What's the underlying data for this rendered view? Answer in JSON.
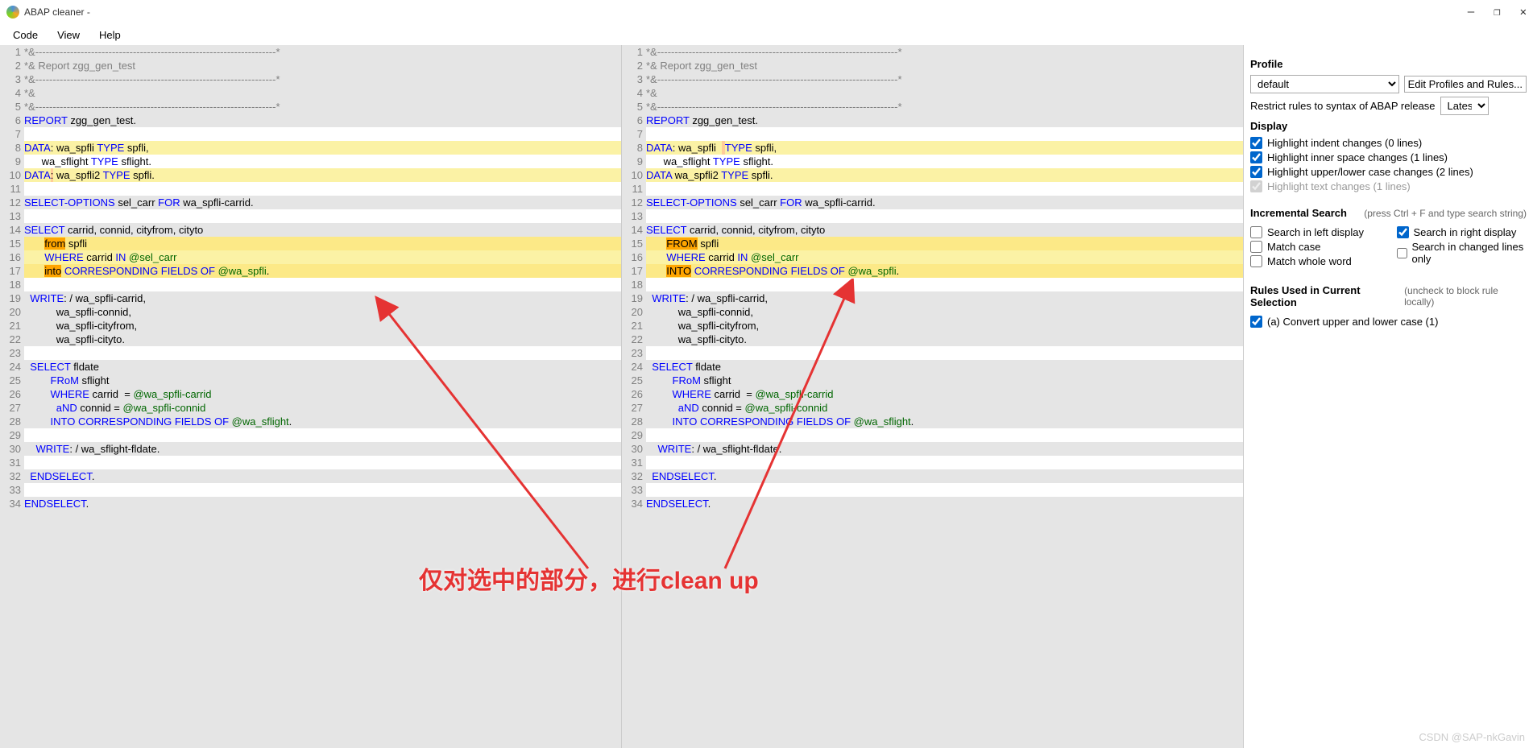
{
  "window": {
    "title": "ABAP cleaner - ",
    "controls": {
      "min": "—",
      "max": "❐",
      "close": "✕"
    }
  },
  "menu": {
    "code": "Code",
    "view": "View",
    "help": "Help"
  },
  "sidebar": {
    "profile_h": "Profile",
    "profile_val": "default",
    "edit_btn": "Edit Profiles and Rules...",
    "restrict": "Restrict rules to syntax of ABAP release",
    "restrict_val": "Latest",
    "display_h": "Display",
    "hl_indent": "Highlight indent changes (0 lines)",
    "hl_inner": "Highlight inner space changes (1 lines)",
    "hl_case": "Highlight upper/lower case changes (2 lines)",
    "hl_text": "Highlight text changes (1 lines)",
    "search_h": "Incremental Search",
    "search_hint": "(press Ctrl + F and type search string)",
    "s_left": "Search in left display",
    "s_right": "Search in right display",
    "s_case": "Match case",
    "s_changed": "Search in changed lines only",
    "s_whole": "Match whole word",
    "rules_h": "Rules Used in Current Selection",
    "rules_hint": "(uncheck to block rule locally)",
    "rule_a": "(a) Convert upper and lower case (1)"
  },
  "annotation": "仅对选中的部分，进行clean up",
  "watermark": "CSDN @SAP-nkGavin",
  "left_code": [
    {
      "n": 1,
      "cls": "bg-e5",
      "h": "<span class=com>*&amp;---------------------------------------------------------------------*</span>"
    },
    {
      "n": 2,
      "cls": "bg-e5",
      "h": "<span class=com>*&amp; Report zgg_gen_test</span>"
    },
    {
      "n": 3,
      "cls": "bg-e5",
      "h": "<span class=com>*&amp;---------------------------------------------------------------------*</span>"
    },
    {
      "n": 4,
      "cls": "bg-e5",
      "h": "<span class=com>*&amp;</span>"
    },
    {
      "n": 5,
      "cls": "bg-e5",
      "h": "<span class=com>*&amp;---------------------------------------------------------------------*</span>"
    },
    {
      "n": 6,
      "cls": "bg-e5",
      "h": "<span class=kw>REPORT</span> zgg_gen_test."
    },
    {
      "n": 7,
      "cls": "bg-ff",
      "h": ""
    },
    {
      "n": 8,
      "cls": "hl-yellow",
      "h": "<span class=kw>DATA</span>: wa_spfli <span class=kw>TYPE</span> spfli,"
    },
    {
      "n": 9,
      "cls": "bg-ff",
      "h": "      wa_sflight <span class=kw>TYPE</span> sflight."
    },
    {
      "n": 10,
      "cls": "hl-yellow",
      "h": "<span class=kw>DATA</span><span class=hl-orange>:</span> wa_spfli2 <span class=kw>TYPE</span> spfli."
    },
    {
      "n": 11,
      "cls": "bg-ff",
      "h": ""
    },
    {
      "n": 12,
      "cls": "bg-e5",
      "h": "<span class=kw>SELECT-OPTIONS</span> sel_carr <span class=kw>FOR</span> wa_spfli-carrid."
    },
    {
      "n": 13,
      "cls": "bg-ff",
      "h": ""
    },
    {
      "n": 14,
      "cls": "bg-e5",
      "h": "<span class=kw>SELECT</span> carrid, connid, cityfrom, cityto"
    },
    {
      "n": 15,
      "cls": "hl-yellow2",
      "h": "       <span class=sel>from</span> spfli"
    },
    {
      "n": 16,
      "cls": "hl-yellow",
      "h": "       <span class=kw>WHERE</span> carrid <span class=kw>IN</span> <span class=at>@sel_carr</span>"
    },
    {
      "n": 17,
      "cls": "hl-yellow2",
      "h": "       <span class=sel>into</span> <span class=kw>CORRESPONDING FIELDS OF</span> <span class=at>@wa_spfli</span>."
    },
    {
      "n": 18,
      "cls": "bg-ff",
      "h": ""
    },
    {
      "n": 19,
      "cls": "bg-e5",
      "h": "  <span class=kw>WRITE</span>: / wa_spfli-carrid,"
    },
    {
      "n": 20,
      "cls": "bg-e5",
      "h": "           wa_spfli-connid,"
    },
    {
      "n": 21,
      "cls": "bg-e5",
      "h": "           wa_spfli-cityfrom,"
    },
    {
      "n": 22,
      "cls": "bg-e5",
      "h": "           wa_spfli-cityto."
    },
    {
      "n": 23,
      "cls": "bg-ff",
      "h": ""
    },
    {
      "n": 24,
      "cls": "bg-e5",
      "h": "  <span class=kw>SELECT</span> fldate"
    },
    {
      "n": 25,
      "cls": "bg-e5",
      "h": "         <span class=kw>FRoM</span> sflight"
    },
    {
      "n": 26,
      "cls": "bg-e5",
      "h": "         <span class=kw>WHERE</span> carrid  = <span class=at>@wa_spfli-carrid</span>"
    },
    {
      "n": 27,
      "cls": "bg-e5",
      "h": "           <span class=kw>aND</span> connid = <span class=at>@wa_spfli-connid</span>"
    },
    {
      "n": 28,
      "cls": "bg-e5",
      "h": "         <span class=kw>INTO CORRESPONDING FIELDS OF</span> <span class=at>@wa_sflight</span>."
    },
    {
      "n": 29,
      "cls": "bg-ff",
      "h": ""
    },
    {
      "n": 30,
      "cls": "bg-e5",
      "h": "    <span class=kw>WRITE</span>: / wa_sflight-fldate."
    },
    {
      "n": 31,
      "cls": "bg-ff",
      "h": ""
    },
    {
      "n": 32,
      "cls": "bg-e5",
      "h": "  <span class=kw>ENDSELECT</span>."
    },
    {
      "n": 33,
      "cls": "bg-ff",
      "h": ""
    },
    {
      "n": 34,
      "cls": "bg-e5",
      "h": "<span class=kw>ENDSELECT</span>."
    }
  ],
  "right_code": [
    {
      "n": 1,
      "cls": "bg-e5",
      "h": "<span class=com>*&amp;---------------------------------------------------------------------*</span>"
    },
    {
      "n": 2,
      "cls": "bg-e5",
      "h": "<span class=com>*&amp; Report zgg_gen_test</span>"
    },
    {
      "n": 3,
      "cls": "bg-e5",
      "h": "<span class=com>*&amp;---------------------------------------------------------------------*</span>"
    },
    {
      "n": 4,
      "cls": "bg-e5",
      "h": "<span class=com>*&amp;</span>"
    },
    {
      "n": 5,
      "cls": "bg-e5",
      "h": "<span class=com>*&amp;---------------------------------------------------------------------*</span>"
    },
    {
      "n": 6,
      "cls": "bg-e5",
      "h": "<span class=kw>REPORT</span> zgg_gen_test."
    },
    {
      "n": 7,
      "cls": "bg-ff",
      "h": ""
    },
    {
      "n": 8,
      "cls": "hl-yellow",
      "h": "<span class=kw>DATA</span>: wa_spfli  <span class=hl-orange> </span><span class=kw>TYPE</span> spfli,"
    },
    {
      "n": 9,
      "cls": "bg-ff",
      "h": "      wa_sflight <span class=kw>TYPE</span> sflight."
    },
    {
      "n": 10,
      "cls": "hl-yellow",
      "h": "<span class=kw>DATA</span> wa_spfli2 <span class=kw>TYPE</span> spfli."
    },
    {
      "n": 11,
      "cls": "bg-ff",
      "h": ""
    },
    {
      "n": 12,
      "cls": "bg-e5",
      "h": "<span class=kw>SELECT-OPTIONS</span> sel_carr <span class=kw>FOR</span> wa_spfli-carrid."
    },
    {
      "n": 13,
      "cls": "bg-ff",
      "h": ""
    },
    {
      "n": 14,
      "cls": "bg-e5",
      "h": "<span class=kw>SELECT</span> carrid, connid, cityfrom, cityto"
    },
    {
      "n": 15,
      "cls": "hl-yellow2",
      "h": "       <span class=sel>FROM</span> spfli"
    },
    {
      "n": 16,
      "cls": "hl-yellow",
      "h": "       <span class=kw>WHERE</span> carrid <span class=kw>IN</span> <span class=at>@sel_carr</span>"
    },
    {
      "n": 17,
      "cls": "hl-yellow2",
      "h": "       <span class=sel>INTO</span> <span class=kw>CORRESPONDING FIELDS OF</span> <span class=at>@wa_spfli</span>."
    },
    {
      "n": 18,
      "cls": "bg-ff",
      "h": ""
    },
    {
      "n": 19,
      "cls": "bg-e5",
      "h": "  <span class=kw>WRITE</span>: / wa_spfli-carrid,"
    },
    {
      "n": 20,
      "cls": "bg-e5",
      "h": "           wa_spfli-connid,"
    },
    {
      "n": 21,
      "cls": "bg-e5",
      "h": "           wa_spfli-cityfrom,"
    },
    {
      "n": 22,
      "cls": "bg-e5",
      "h": "           wa_spfli-cityto."
    },
    {
      "n": 23,
      "cls": "bg-ff",
      "h": ""
    },
    {
      "n": 24,
      "cls": "bg-e5",
      "h": "  <span class=kw>SELECT</span> fldate"
    },
    {
      "n": 25,
      "cls": "bg-e5",
      "h": "         <span class=kw>FRoM</span> sflight"
    },
    {
      "n": 26,
      "cls": "bg-e5",
      "h": "         <span class=kw>WHERE</span> carrid  = <span class=at>@wa_spfli-carrid</span>"
    },
    {
      "n": 27,
      "cls": "bg-e5",
      "h": "           <span class=kw>aND</span> connid = <span class=at>@wa_spfli-connid</span>"
    },
    {
      "n": 28,
      "cls": "bg-e5",
      "h": "         <span class=kw>INTO CORRESPONDING FIELDS OF</span> <span class=at>@wa_sflight</span>."
    },
    {
      "n": 29,
      "cls": "bg-ff",
      "h": ""
    },
    {
      "n": 30,
      "cls": "bg-e5",
      "h": "    <span class=kw>WRITE</span>: / wa_sflight-fldate."
    },
    {
      "n": 31,
      "cls": "bg-ff",
      "h": ""
    },
    {
      "n": 32,
      "cls": "bg-e5",
      "h": "  <span class=kw>ENDSELECT</span>."
    },
    {
      "n": 33,
      "cls": "bg-ff",
      "h": ""
    },
    {
      "n": 34,
      "cls": "bg-e5",
      "h": "<span class=kw>ENDSELECT</span>."
    }
  ]
}
